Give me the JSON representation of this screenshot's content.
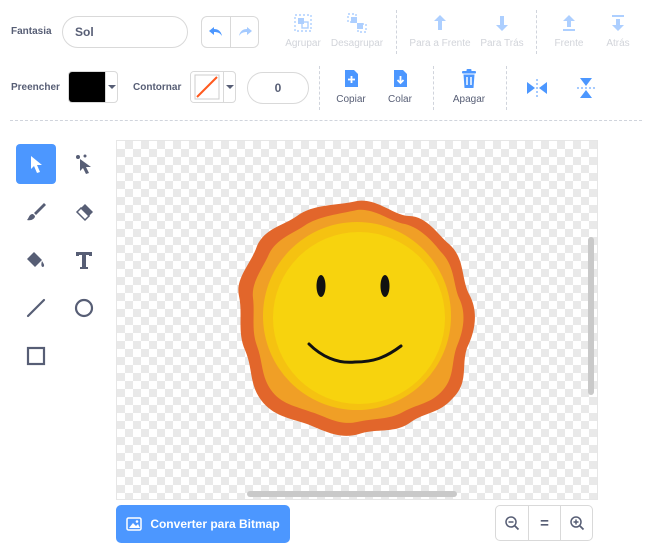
{
  "row1": {
    "costume_label": "Fantasia",
    "costume_name": "Sol",
    "group": "Agrupar",
    "ungroup": "Desagrupar",
    "forward": "Para a Frente",
    "backward": "Para Trás",
    "front": "Frente",
    "back": "Atrás"
  },
  "row2": {
    "fill_label": "Preencher",
    "fill_color": "#000000",
    "outline_label": "Contornar",
    "outline_width": "0",
    "copy": "Copiar",
    "paste": "Colar",
    "delete": "Apagar"
  },
  "bottom": {
    "convert": "Converter para Bitmap",
    "zoom_reset": "="
  },
  "colors": {
    "accent": "#4c97ff",
    "sun_outer": "#e2662b",
    "sun_mid": "#f09f26",
    "sun_inner": "#f5c211",
    "sun_face": "#f7d30e"
  }
}
